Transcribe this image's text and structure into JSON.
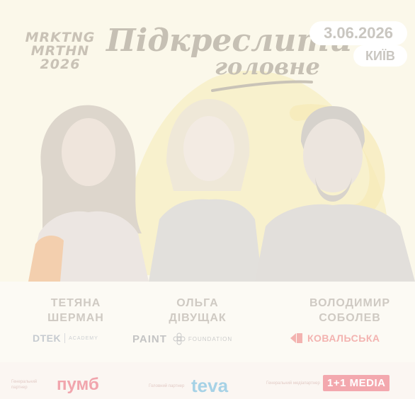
{
  "event": {
    "brand_lines": [
      "MRKTNG",
      "MRTHN",
      "2026"
    ],
    "headline_line1": "Підкреслити",
    "headline_line2": "головне",
    "date": "3.06.2026",
    "city": "КИЇВ"
  },
  "speakers": [
    {
      "name_line1": "ТЕТЯНА",
      "name_line2": "ШЕРМАН",
      "logo_main": "DTEK",
      "logo_sub": "ACADEMY"
    },
    {
      "name_line1": "ОЛЬГА",
      "name_line2": "ДІВУЩАК",
      "logo_main": "PAINT",
      "logo_sub": "FOUNDATION"
    },
    {
      "name_line1": "ВОЛОДИМИР",
      "name_line2": "СОБОЛЕВ",
      "logo_main": "КОВАЛЬСЬКА"
    }
  ],
  "partners": [
    {
      "label": "Генеральний партнер",
      "logo": "пумб"
    },
    {
      "label": "Головний партнер",
      "logo": "teva"
    },
    {
      "label": "Генеральний медіапартнер",
      "logo": "1+1 MEDIA"
    }
  ],
  "colors": {
    "background": "#fbf8ea",
    "accent_yellow": "#f8efc6",
    "text_muted": "#cfcac3",
    "partner_red": "#f1a5ad",
    "partner_blue": "#a6d2e6"
  }
}
